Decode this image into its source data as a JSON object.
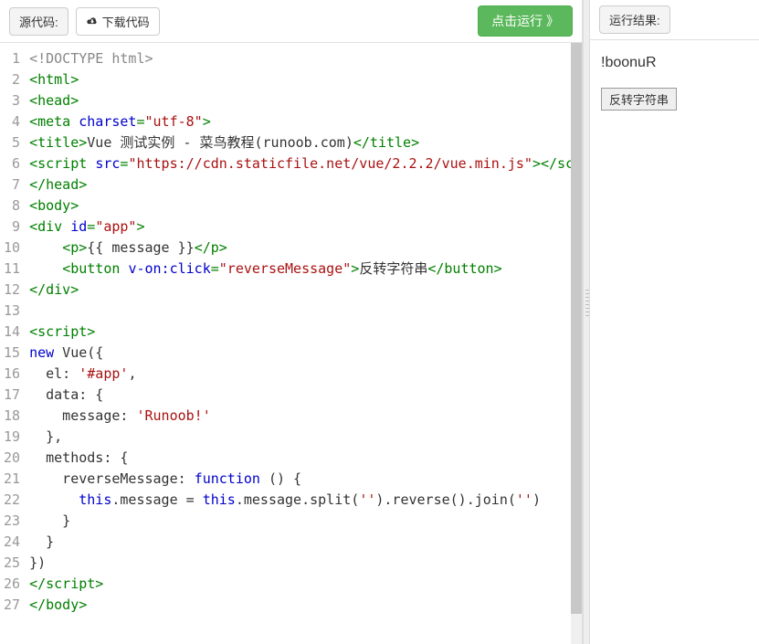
{
  "toolbar": {
    "source_label": "源代码:",
    "download_label": "下载代码",
    "run_label": "点击运行 》"
  },
  "result": {
    "label": "运行结果:",
    "message": "!boonuR",
    "button_label": "反转字符串"
  },
  "code_lines": [
    {
      "n": 1,
      "tokens": [
        {
          "c": "t-doctype",
          "t": "<!DOCTYPE html>"
        }
      ]
    },
    {
      "n": 2,
      "tokens": [
        {
          "c": "t-tag",
          "t": "<html>"
        }
      ]
    },
    {
      "n": 3,
      "tokens": [
        {
          "c": "t-tag",
          "t": "<head>"
        }
      ]
    },
    {
      "n": 4,
      "tokens": [
        {
          "c": "t-tag",
          "t": "<meta"
        },
        {
          "c": "t-text",
          "t": " "
        },
        {
          "c": "t-attr",
          "t": "charset"
        },
        {
          "c": "t-tag",
          "t": "="
        },
        {
          "c": "t-str",
          "t": "\"utf-8\""
        },
        {
          "c": "t-tag",
          "t": ">"
        }
      ]
    },
    {
      "n": 5,
      "tokens": [
        {
          "c": "t-tag",
          "t": "<title>"
        },
        {
          "c": "t-text",
          "t": "Vue 测试实例 - 菜鸟教程(runoob.com)"
        },
        {
          "c": "t-tag",
          "t": "</title>"
        }
      ]
    },
    {
      "n": 6,
      "tokens": [
        {
          "c": "t-tag",
          "t": "<script"
        },
        {
          "c": "t-text",
          "t": " "
        },
        {
          "c": "t-attr",
          "t": "src"
        },
        {
          "c": "t-tag",
          "t": "="
        },
        {
          "c": "t-str",
          "t": "\"https://cdn.staticfile.net/vue/2.2.2/vue.min.js\""
        },
        {
          "c": "t-tag",
          "t": "></"
        },
        {
          "c": "t-tag",
          "t": "script>"
        }
      ]
    },
    {
      "n": 7,
      "tokens": [
        {
          "c": "t-tag",
          "t": "</head>"
        }
      ]
    },
    {
      "n": 8,
      "tokens": [
        {
          "c": "t-tag",
          "t": "<body>"
        }
      ]
    },
    {
      "n": 9,
      "tokens": [
        {
          "c": "t-tag",
          "t": "<div"
        },
        {
          "c": "t-text",
          "t": " "
        },
        {
          "c": "t-attr",
          "t": "id"
        },
        {
          "c": "t-tag",
          "t": "="
        },
        {
          "c": "t-str",
          "t": "\"app\""
        },
        {
          "c": "t-tag",
          "t": ">"
        }
      ]
    },
    {
      "n": 10,
      "tokens": [
        {
          "c": "t-text",
          "t": "    "
        },
        {
          "c": "t-tag",
          "t": "<p>"
        },
        {
          "c": "t-text",
          "t": "{{ message }}"
        },
        {
          "c": "t-tag",
          "t": "</p>"
        }
      ]
    },
    {
      "n": 11,
      "tokens": [
        {
          "c": "t-text",
          "t": "    "
        },
        {
          "c": "t-tag",
          "t": "<button"
        },
        {
          "c": "t-text",
          "t": " "
        },
        {
          "c": "t-attr",
          "t": "v-on:click"
        },
        {
          "c": "t-tag",
          "t": "="
        },
        {
          "c": "t-str",
          "t": "\"reverseMessage\""
        },
        {
          "c": "t-tag",
          "t": ">"
        },
        {
          "c": "t-text",
          "t": "反转字符串"
        },
        {
          "c": "t-tag",
          "t": "</button>"
        }
      ]
    },
    {
      "n": 12,
      "tokens": [
        {
          "c": "t-tag",
          "t": "</div>"
        }
      ]
    },
    {
      "n": 13,
      "tokens": [
        {
          "c": "t-text",
          "t": ""
        }
      ]
    },
    {
      "n": 14,
      "tokens": [
        {
          "c": "t-tag",
          "t": "<script>"
        }
      ]
    },
    {
      "n": 15,
      "tokens": [
        {
          "c": "t-keyword",
          "t": "new"
        },
        {
          "c": "t-text",
          "t": " Vue({"
        }
      ]
    },
    {
      "n": 16,
      "tokens": [
        {
          "c": "t-text",
          "t": "  el: "
        },
        {
          "c": "t-str",
          "t": "'#app'"
        },
        {
          "c": "t-text",
          "t": ","
        }
      ]
    },
    {
      "n": 17,
      "tokens": [
        {
          "c": "t-text",
          "t": "  data: {"
        }
      ]
    },
    {
      "n": 18,
      "tokens": [
        {
          "c": "t-text",
          "t": "    message: "
        },
        {
          "c": "t-str",
          "t": "'Runoob!'"
        }
      ]
    },
    {
      "n": 19,
      "tokens": [
        {
          "c": "t-text",
          "t": "  },"
        }
      ]
    },
    {
      "n": 20,
      "tokens": [
        {
          "c": "t-text",
          "t": "  methods: {"
        }
      ]
    },
    {
      "n": 21,
      "tokens": [
        {
          "c": "t-text",
          "t": "    reverseMessage: "
        },
        {
          "c": "t-keyword",
          "t": "function"
        },
        {
          "c": "t-text",
          "t": " () {"
        }
      ]
    },
    {
      "n": 22,
      "tokens": [
        {
          "c": "t-text",
          "t": "      "
        },
        {
          "c": "t-keyword",
          "t": "this"
        },
        {
          "c": "t-text",
          "t": ".message = "
        },
        {
          "c": "t-keyword",
          "t": "this"
        },
        {
          "c": "t-text",
          "t": ".message.split("
        },
        {
          "c": "t-str",
          "t": "''"
        },
        {
          "c": "t-text",
          "t": ").reverse().join("
        },
        {
          "c": "t-str",
          "t": "''"
        },
        {
          "c": "t-text",
          "t": ")"
        }
      ]
    },
    {
      "n": 23,
      "tokens": [
        {
          "c": "t-text",
          "t": "    }"
        }
      ]
    },
    {
      "n": 24,
      "tokens": [
        {
          "c": "t-text",
          "t": "  }"
        }
      ]
    },
    {
      "n": 25,
      "tokens": [
        {
          "c": "t-text",
          "t": "})"
        }
      ]
    },
    {
      "n": 26,
      "tokens": [
        {
          "c": "t-tag",
          "t": "</"
        },
        {
          "c": "t-tag",
          "t": "script>"
        }
      ]
    },
    {
      "n": 27,
      "tokens": [
        {
          "c": "t-tag",
          "t": "</body>"
        }
      ]
    }
  ]
}
